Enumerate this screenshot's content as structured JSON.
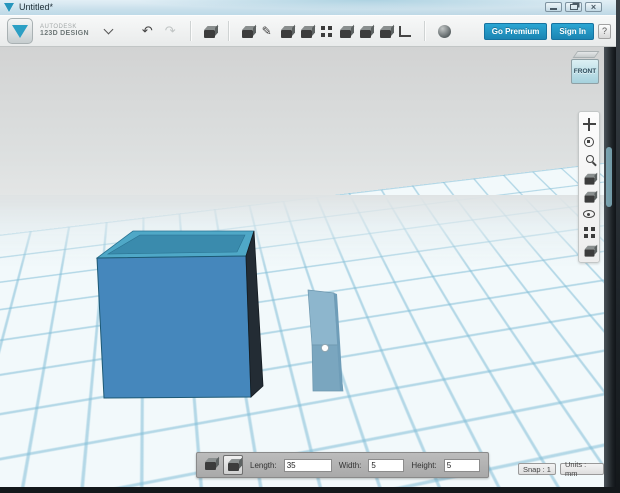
{
  "titlebar": {
    "title": "Untitled*"
  },
  "window_controls": {
    "close_glyph": "×",
    "icon_names": [
      "minimize",
      "restore",
      "close"
    ]
  },
  "toolbar": {
    "brand_line1": "AUTODESK",
    "brand_line2": "123D DESIGN",
    "undo_glyph": "↶",
    "redo_glyph": "↷",
    "sketch_glyph": "✎",
    "go_premium_label": "Go Premium",
    "sign_in_label": "Sign In",
    "help_label": "?",
    "icon_names": [
      "app-logo",
      "menu-chevron",
      "undo",
      "redo",
      "transform",
      "primitives",
      "sketch",
      "construct",
      "modify",
      "pattern",
      "grouping",
      "combine",
      "measure",
      "ruler",
      "material"
    ]
  },
  "viewcube": {
    "label": "FRONT"
  },
  "sidebar": {
    "icon_names": [
      "pan",
      "orbit",
      "zoom",
      "fit",
      "view",
      "visibility",
      "grid",
      "snap"
    ]
  },
  "bottom_panel": {
    "length_label": "Length:",
    "length_value": "35",
    "width_label": "Width:",
    "width_value": "5",
    "height_label": "Height:",
    "height_value": "5"
  },
  "statusbar": {
    "snap_label": "Snap : 1",
    "units_label": "Units : mm"
  },
  "scene": {
    "objects": [
      "hollow-box",
      "rectangular-bar"
    ],
    "colors": {
      "box_front": "#4587bc",
      "box_rim": "#4fa8c7",
      "box_inner": "#3a8bad",
      "box_side": "#232c34",
      "box_edge": "#1d5974",
      "bar_upper": "#8db6cd",
      "bar_lower": "#7aa6bf",
      "bar_side": "#6f9db8",
      "grid_line": "#9ecfe2",
      "accent_blue": "#1f98c7"
    }
  }
}
